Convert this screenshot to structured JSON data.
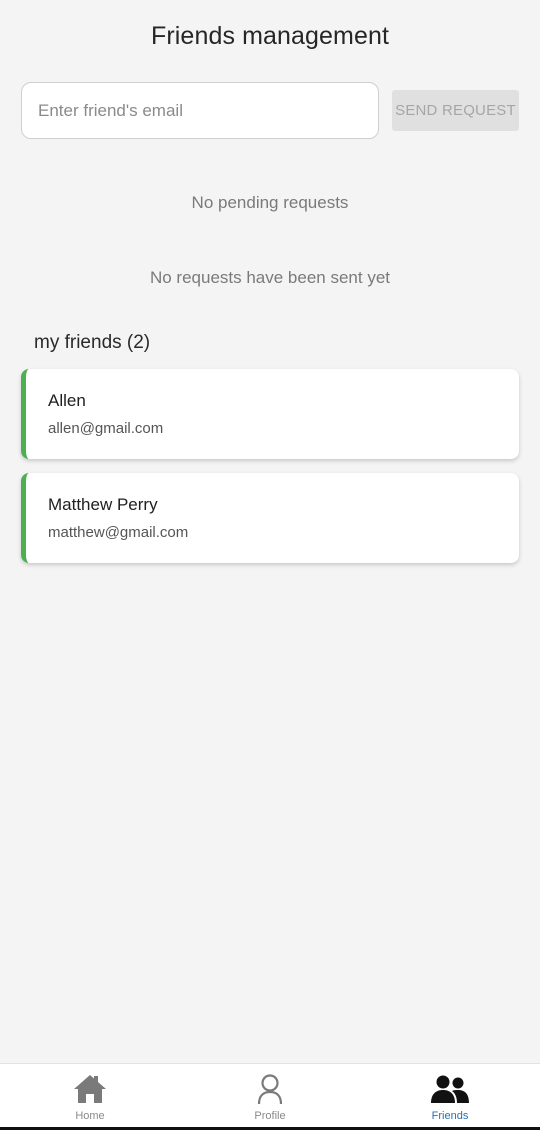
{
  "header": {
    "title": "Friends management"
  },
  "request_form": {
    "email_placeholder": "Enter friend's email",
    "email_value": "",
    "send_label": "SEND REQUEST"
  },
  "pending": {
    "empty_text": "No pending requests"
  },
  "sent": {
    "empty_text": "No requests have been sent yet"
  },
  "friends": {
    "heading": "my friends (2)",
    "items": [
      {
        "name": "Allen",
        "email": "allen@gmail.com"
      },
      {
        "name": "Matthew Perry",
        "email": "matthew@gmail.com"
      }
    ]
  },
  "nav": {
    "items": [
      {
        "label": "Home",
        "icon": "home-icon",
        "active": false
      },
      {
        "label": "Profile",
        "icon": "person-icon",
        "active": false
      },
      {
        "label": "Friends",
        "icon": "users-icon",
        "active": true
      }
    ]
  },
  "colors": {
    "background": "#f4f4f4",
    "card_accent": "#4caf50",
    "nav_active": "#2a6fb5",
    "nav_inactive": "#8a8a8a",
    "button_disabled_bg": "#e0e0e0",
    "button_disabled_text": "#a6a6a6"
  }
}
